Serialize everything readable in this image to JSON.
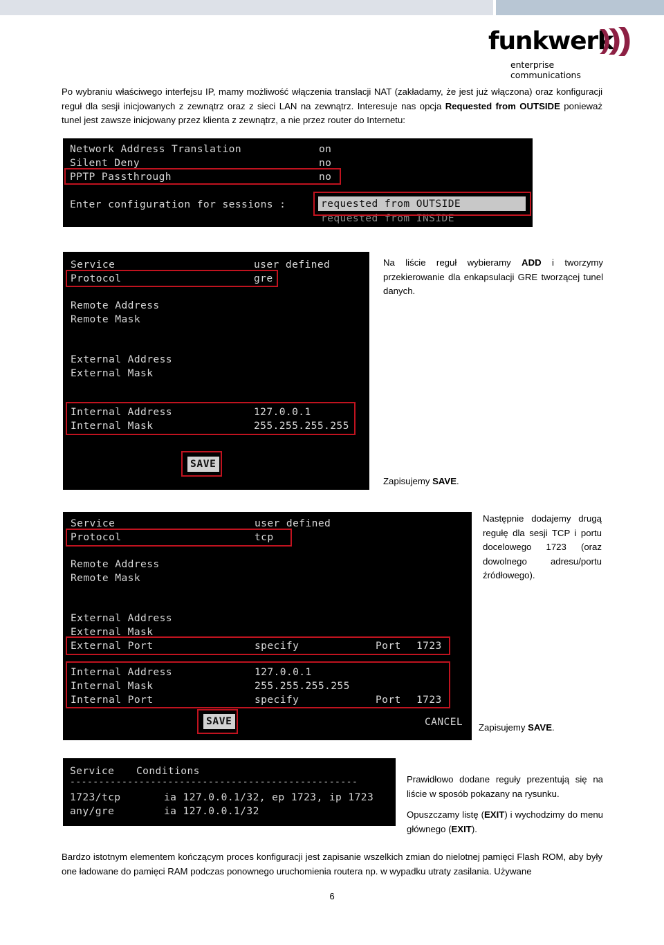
{
  "banner": {
    "left_color": "#dde1e8",
    "right_color": "#b8c6d4"
  },
  "logo": {
    "wordmark": "funkwerk",
    "tagline": "enterprise communications",
    "wave_color": "#8d2044",
    "text_color": "#000000"
  },
  "intro": {
    "text_1": "Po wybraniu właściwego interfejsu IP, mamy możliwość włączenia translacji NAT (zakładamy, że jest już włączona) oraz konfiguracji reguł dla sesji inicjowanych z zewnątrz oraz z sieci LAN na zewnątrz. Interesuje nas opcja ",
    "bold_1": "Requested from OUTSIDE",
    "text_2": " ponieważ tunel jest zawsze inicjowany przez klienta z zewnątrz, a nie przez router do Internetu:"
  },
  "terminal_nat": {
    "rows": [
      {
        "label": "Network Address Translation",
        "value": "on"
      },
      {
        "label": "Silent Deny",
        "value": "no"
      },
      {
        "label": "PPTP Passthrough",
        "value": "no"
      }
    ],
    "prompt": "Enter configuration for sessions :",
    "option_selected": "requested from OUTSIDE",
    "option_other": "requested from INSIDE"
  },
  "terminal_gre": {
    "rows": [
      {
        "label": "Service",
        "value": "user defined"
      },
      {
        "label": "Protocol",
        "value": "gre"
      },
      {
        "label": "Remote Address",
        "value": ""
      },
      {
        "label": "Remote Mask",
        "value": ""
      },
      {
        "label": "External Address",
        "value": ""
      },
      {
        "label": "External Mask",
        "value": ""
      },
      {
        "label": "Internal Address",
        "value": "127.0.0.1"
      },
      {
        "label": "Internal Mask",
        "value": "255.255.255.255"
      }
    ],
    "save_label": "SAVE"
  },
  "terminal_tcp": {
    "rows": [
      {
        "label": "Service",
        "value": "user defined"
      },
      {
        "label": "Protocol",
        "value": "tcp"
      },
      {
        "label": "Remote Address",
        "value": ""
      },
      {
        "label": "Remote Mask",
        "value": ""
      },
      {
        "label": "External Address",
        "value": ""
      },
      {
        "label": "External Mask",
        "value": ""
      },
      {
        "label": "External Port",
        "value": "specify",
        "port_label": "Port",
        "port": "1723"
      },
      {
        "label": "Internal Address",
        "value": "127.0.0.1"
      },
      {
        "label": "Internal Mask",
        "value": "255.255.255.255"
      },
      {
        "label": "Internal Port",
        "value": "specify",
        "port_label": "Port",
        "port": "1723"
      }
    ],
    "save_label": "SAVE",
    "cancel_label": "CANCEL"
  },
  "terminal_list": {
    "header_service": "Service",
    "header_conditions": "Conditions",
    "separator": "--------------------------------------------------",
    "rows": [
      {
        "service": "1723/tcp",
        "conditions": "ia 127.0.0.1/32, ep 1723, ip 1723"
      },
      {
        "service": "any/gre",
        "conditions": "ia 127.0.0.1/32"
      }
    ]
  },
  "notes": {
    "add_1": "Na liście reguł wybieramy ",
    "add_bold": "ADD",
    "add_2": " i tworzymy przekierowanie dla enkapsulacji GRE tworzącej tunel danych.",
    "save1_1": "Zapisujemy ",
    "save1_bold": "SAVE",
    "save1_2": ".",
    "tcp": "Następnie dodajemy drugą regułę dla sesji TCP i portu docelowego 1723 (oraz dowolnego adresu/portu źródłowego).",
    "save2_1": "Zapisujemy ",
    "save2_bold": "SAVE",
    "save2_2": ".",
    "list": "Prawidłowo dodane reguły prezentują się na liście w sposób pokazany na rysunku.",
    "exit_1": "Opuszczamy listę (",
    "exit_bold_1": "EXIT",
    "exit_2": ") i wychodzimy do menu głównego (",
    "exit_bold_2": "EXIT",
    "exit_3": ")."
  },
  "closing": {
    "text": "Bardzo istotnym elementem kończącym proces konfiguracji jest zapisanie wszelkich zmian do nielotnej pamięci Flash ROM, aby były one ładowane do pamięci RAM podczas ponownego uruchomienia routera np. w wypadku utraty zasilania. Używane"
  },
  "page": {
    "number": "6"
  },
  "colors": {
    "annotation_red": "#c0131f",
    "terminal_bg": "#000000",
    "terminal_fg": "#d9d9d9",
    "highlight_bg": "#c8c8c8"
  }
}
